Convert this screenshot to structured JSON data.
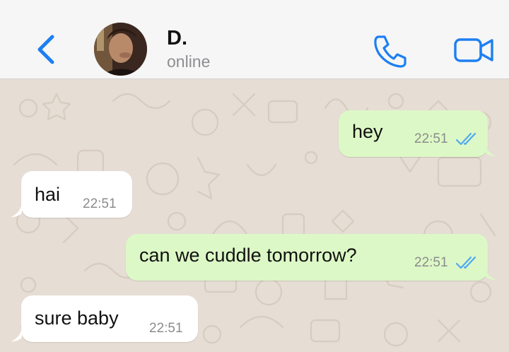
{
  "header": {
    "contact_name": "D.",
    "contact_status": "online",
    "back_icon": "chevron-left-icon",
    "call_icon": "phone-icon",
    "video_icon": "video-camera-icon",
    "accent_color": "#1d7ff2"
  },
  "messages": [
    {
      "direction": "outgoing",
      "text": "hey",
      "time": "22:51",
      "status": "read"
    },
    {
      "direction": "incoming",
      "text": "hai",
      "time": "22:51"
    },
    {
      "direction": "outgoing",
      "text": "can we cuddle tomorrow?",
      "time": "22:51",
      "status": "read"
    },
    {
      "direction": "incoming",
      "text": "sure baby",
      "time": "22:51"
    }
  ],
  "colors": {
    "outgoing_bubble": "#dcf8c6",
    "incoming_bubble": "#ffffff",
    "wallpaper": "#e6ddd4",
    "read_ticks": "#4fa9f1"
  }
}
